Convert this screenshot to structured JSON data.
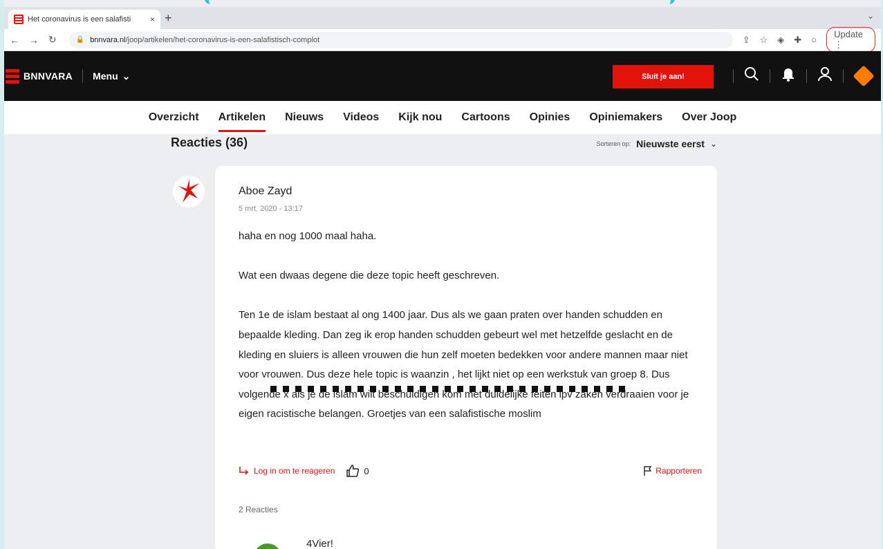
{
  "browser": {
    "tab_title": "Het coronavirus is een salafisti",
    "tab_close": "×",
    "new_tab": "+",
    "tab_menu": "⌄",
    "url_domain": "bnnvara.nl",
    "url_path": "/joop/artikelen/het-coronavirus-is-een-salafistisch-complot",
    "update_label": "Update"
  },
  "site": {
    "logo_text": "BNNVARA",
    "menu_label": "Menu",
    "join_label": "Sluit je aan!"
  },
  "subnav": [
    {
      "label": "Overzicht",
      "active": false
    },
    {
      "label": "Artikelen",
      "active": true
    },
    {
      "label": "Nieuws",
      "active": false
    },
    {
      "label": "Videos",
      "active": false
    },
    {
      "label": "Kijk nou",
      "active": false
    },
    {
      "label": "Cartoons",
      "active": false
    },
    {
      "label": "Opinies",
      "active": false
    },
    {
      "label": "Opiniemakers",
      "active": false
    },
    {
      "label": "Over Joop",
      "active": false
    }
  ],
  "reactions": {
    "title": "Reacties (36)",
    "sort_label": "Sorteren op:",
    "sort_value": "Nieuwste eerst"
  },
  "comment": {
    "author": "Aboe Zayd",
    "date": "5 mrt. 2020 - 13:17",
    "paragraphs": [
      "haha en nog 1000 maal haha.",
      "Wat een dwaas degene die deze topic heeft geschreven.",
      "Ten 1e de islam bestaat al ong 1400 jaar. Dus als we gaan praten over handen schudden en bepaalde kleding. Dan zeg ik erop handen schudden gebeurt wel met hetzelfde geslacht en de kleding en sluiers is alleen vrouwen die hun zelf moeten bedekken voor andere mannen maar niet voor vrouwen. Dus deze hele topic is waanzin , het lijkt niet op een werkstuk van groep 8. Dus volgende x als je de islam wilt beschuldigen kom met duidelijke feiten ipv zaken verdraaien voor je eigen racistische belangen. Groetjes van een salafistische moslim"
    ],
    "login_label": "Log in om te reageren",
    "like_count": "0",
    "report_label": "Rapporteren",
    "replies_label": "2 Reacties"
  },
  "reply": {
    "author": "4Vier!"
  },
  "colors": {
    "brand_red": "#e3120b",
    "npo_orange": "#ff7a00"
  }
}
